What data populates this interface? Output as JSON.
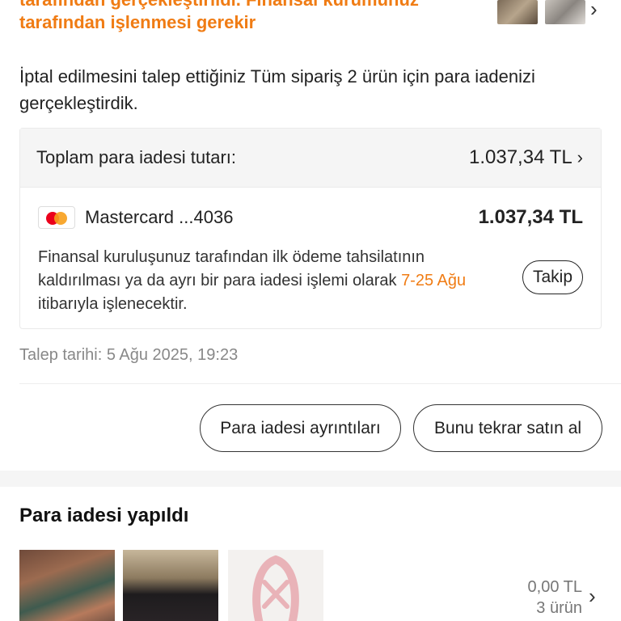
{
  "banner": {
    "line1": "tarafından gerçekleştirildi. Finansal kurumunuz",
    "line2": "tarafından işlenmesi gerekir"
  },
  "intro_text": "İptal edilmesini talep ettiğiniz Tüm sipariş 2 ürün için para iadenizi gerçekleştirdik.",
  "refund_card": {
    "total_label": "Toplam para iadesi tutarı:",
    "total_amount": "1.037,34 TL",
    "payment_method": "Mastercard ...4036",
    "payment_amount": "1.037,34 TL",
    "info_before": "Finansal kuruluşunuz tarafından ilk ödeme tahsilatının kaldırılması ya da ayrı bir para iadesi işlemi olarak ",
    "info_highlight": "7-25 Ağu",
    "info_after": " itibarıyla işlenecektir.",
    "track_button": "Takip"
  },
  "request_date": "Talep tarihi: 5 Ağu 2025, 19:23",
  "actions": {
    "details_button": "Para iadesi ayrıntıları",
    "rebuy_button": "Bunu tekrar satın al"
  },
  "refunded_section": {
    "title": "Para iadesi yapıldı",
    "amount": "0,00 TL",
    "count": "3 ürün"
  },
  "icons": {
    "card_brand": "mastercard-icon",
    "chevron": "chevron-right-icon"
  },
  "colors": {
    "accent": "#f07c14",
    "mastercard_red": "#eb001b",
    "mastercard_yellow": "#f79e1b"
  }
}
